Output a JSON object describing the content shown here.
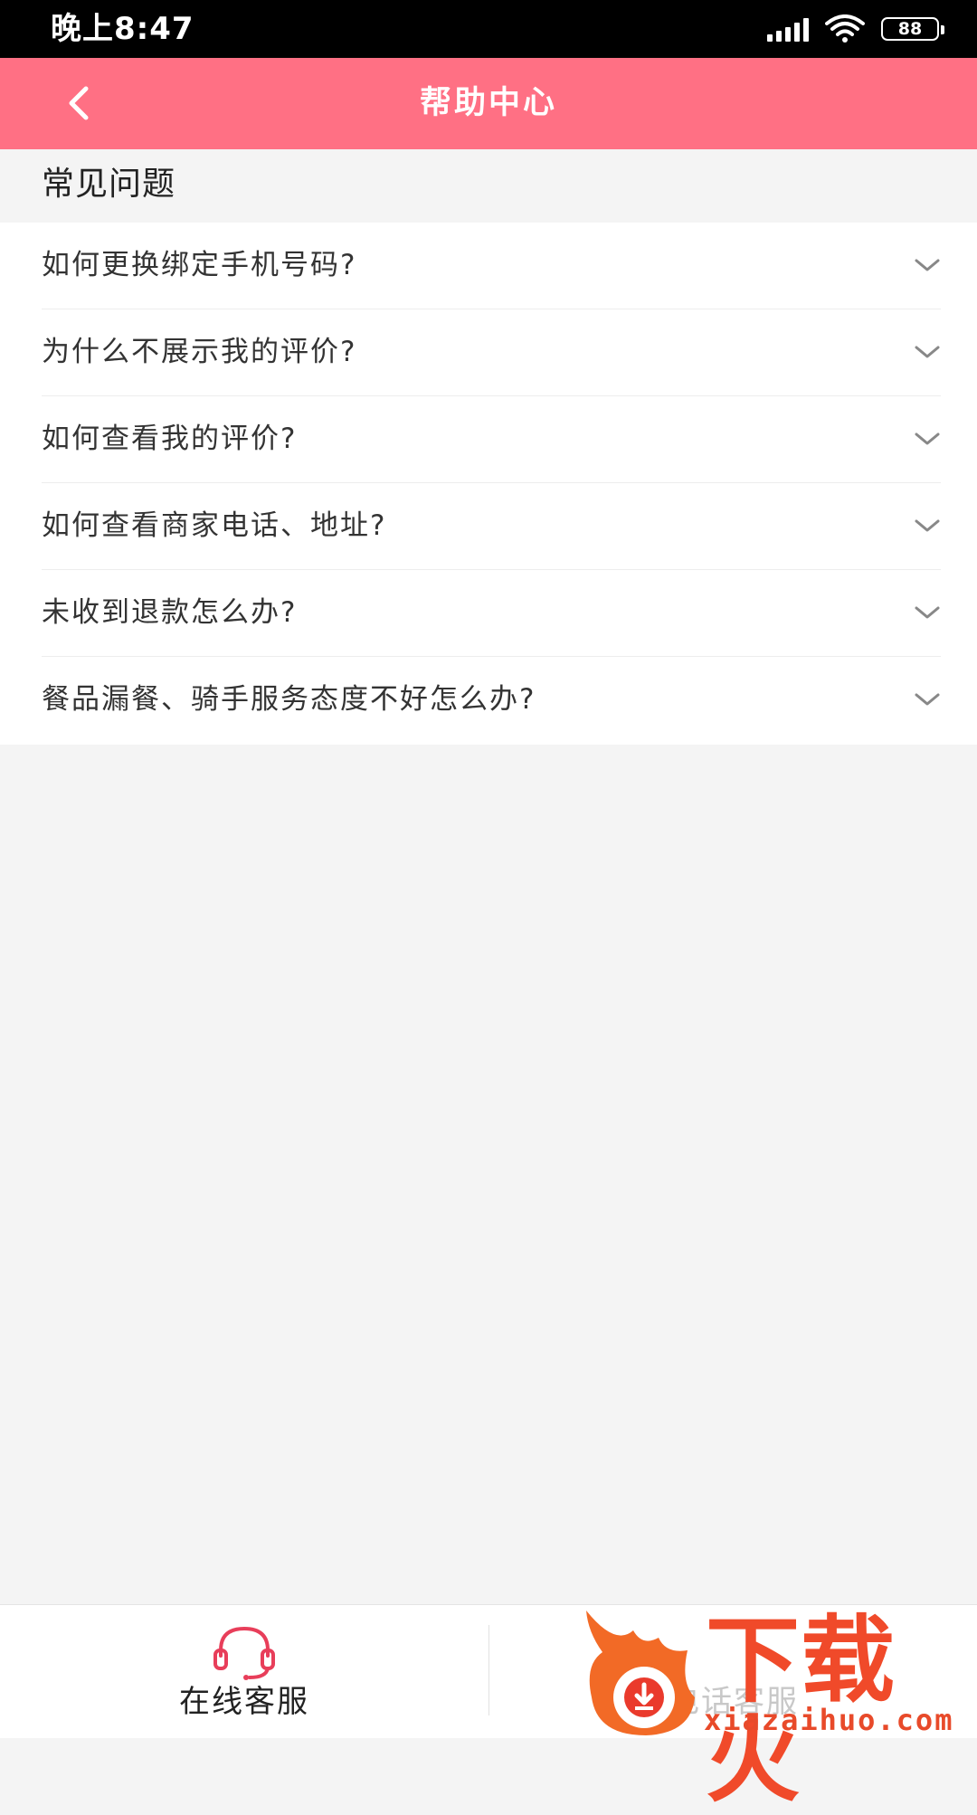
{
  "status_bar": {
    "time": "晚上8:47",
    "battery": "88"
  },
  "header": {
    "title": "帮助中心"
  },
  "faq": {
    "section_title": "常见问题",
    "items": [
      {
        "question": "如何更换绑定手机号码?"
      },
      {
        "question": "为什么不展示我的评价?"
      },
      {
        "question": "如何查看我的评价?"
      },
      {
        "question": "如何查看商家电话、地址?"
      },
      {
        "question": "未收到退款怎么办?"
      },
      {
        "question": "餐品漏餐、骑手服务态度不好怎么办?"
      }
    ]
  },
  "bottom_bar": {
    "online_service": "在线客服",
    "phone_service": "电话客服"
  },
  "watermark": {
    "text": "下载火",
    "url": "xiazaihuo.com"
  },
  "colors": {
    "header": "#ff7084",
    "accent": "#e83e5a",
    "watermark": "#f04a2a"
  }
}
